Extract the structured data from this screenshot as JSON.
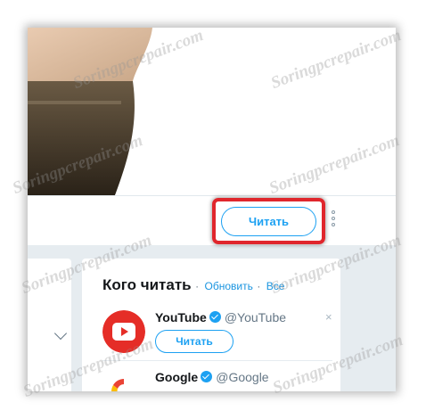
{
  "profile": {
    "follow_label": "Читать"
  },
  "who_to_follow": {
    "title": "Кого читать",
    "refresh_label": "Обновить",
    "separator": "·",
    "all_label": "Все",
    "accounts": [
      {
        "name": "YouTube",
        "handle": "@YouTube",
        "button_label": "Читать",
        "close": "×"
      },
      {
        "name": "Google",
        "handle": "@Google"
      }
    ]
  },
  "watermark": {
    "text": "Soringpcrepair.com"
  },
  "colors": {
    "accent": "#1da1f2",
    "highlight": "#e0262c",
    "youtube": "#e52d27"
  }
}
